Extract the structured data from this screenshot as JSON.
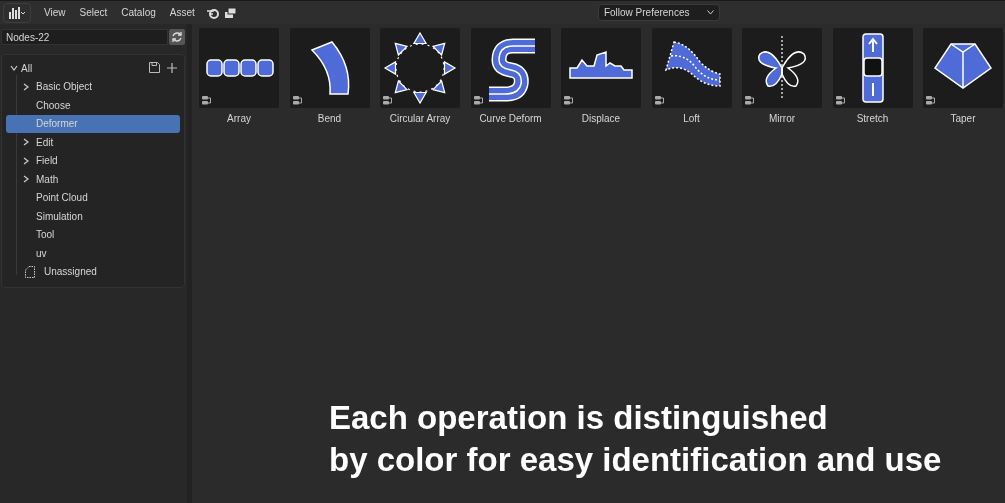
{
  "menu_bar": {
    "menus": [
      "View",
      "Select",
      "Catalog",
      "Asset"
    ],
    "import_method": "Follow Preferences"
  },
  "library": {
    "value": "Nodes-22"
  },
  "catalog_tree": {
    "root": {
      "label": "All",
      "expanded": true,
      "selected": false,
      "children": [
        {
          "label": "Basic Object",
          "expanded": false,
          "selected": false
        },
        {
          "label": "Choose",
          "selected": false
        },
        {
          "label": "Deformer",
          "selected": true
        },
        {
          "label": "Edit",
          "expanded": false,
          "selected": false
        },
        {
          "label": "Field",
          "expanded": false,
          "selected": false
        },
        {
          "label": "Math",
          "expanded": false,
          "selected": false
        },
        {
          "label": "Point Cloud",
          "selected": false
        },
        {
          "label": "Simulation",
          "selected": false
        },
        {
          "label": "Tool",
          "selected": false
        },
        {
          "label": "uv",
          "selected": false
        }
      ]
    },
    "unassigned": {
      "label": "Unassigned",
      "selected": false
    }
  },
  "assets": [
    {
      "name": "Array"
    },
    {
      "name": "Bend"
    },
    {
      "name": "Circular Array"
    },
    {
      "name": "Curve Deform"
    },
    {
      "name": "Displace"
    },
    {
      "name": "Loft"
    },
    {
      "name": "Mirror"
    },
    {
      "name": "Stretch"
    },
    {
      "name": "Taper"
    }
  ],
  "caption": [
    "Each operation is distinguished",
    "by color for easy identification and use"
  ]
}
